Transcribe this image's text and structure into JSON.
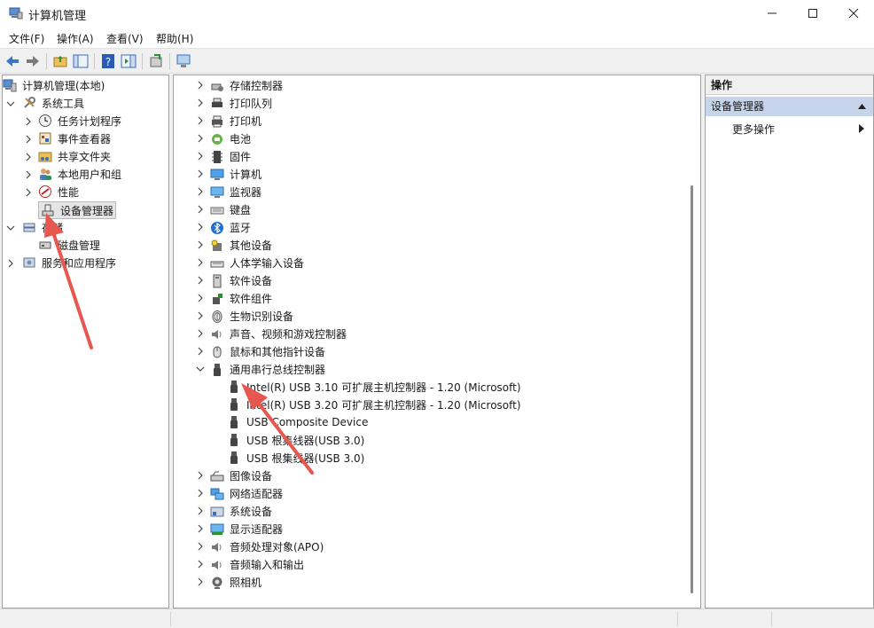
{
  "window": {
    "title": "计算机管理"
  },
  "menu": [
    "文件(F)",
    "操作(A)",
    "查看(V)",
    "帮助(H)"
  ],
  "left_tree": [
    {
      "label": "计算机管理(本地)",
      "icon": "computer-management-icon",
      "indent": 0,
      "chevron": "none"
    },
    {
      "label": "系统工具",
      "icon": "tools-icon",
      "indent": 1,
      "chevron": "down"
    },
    {
      "label": "任务计划程序",
      "icon": "clock-icon",
      "indent": 2,
      "chevron": "right"
    },
    {
      "label": "事件查看器",
      "icon": "event-viewer-icon",
      "indent": 2,
      "chevron": "right"
    },
    {
      "label": "共享文件夹",
      "icon": "shared-folder-icon",
      "indent": 2,
      "chevron": "right"
    },
    {
      "label": "本地用户和组",
      "icon": "users-icon",
      "indent": 2,
      "chevron": "right"
    },
    {
      "label": "性能",
      "icon": "performance-icon",
      "indent": 2,
      "chevron": "right"
    },
    {
      "label": "设备管理器",
      "icon": "device-manager-icon",
      "indent": 2,
      "chevron": "none",
      "selected": true
    },
    {
      "label": "存储",
      "icon": "storage-icon",
      "indent": 1,
      "chevron": "down"
    },
    {
      "label": "磁盘管理",
      "icon": "disk-management-icon",
      "indent": 2,
      "chevron": "none"
    },
    {
      "label": "服务和应用程序",
      "icon": "services-icon",
      "indent": 1,
      "chevron": "right"
    }
  ],
  "device_tree": [
    {
      "label": "存储控制器",
      "icon": "storage-controller-icon",
      "expanded": false
    },
    {
      "label": "打印队列",
      "icon": "print-queue-icon",
      "expanded": false
    },
    {
      "label": "打印机",
      "icon": "printer-icon",
      "expanded": false
    },
    {
      "label": "电池",
      "icon": "battery-icon",
      "expanded": false
    },
    {
      "label": "固件",
      "icon": "firmware-icon",
      "expanded": false
    },
    {
      "label": "计算机",
      "icon": "computer-icon",
      "expanded": false
    },
    {
      "label": "监视器",
      "icon": "monitor-icon",
      "expanded": false
    },
    {
      "label": "键盘",
      "icon": "keyboard-icon",
      "expanded": false
    },
    {
      "label": "蓝牙",
      "icon": "bluetooth-icon",
      "expanded": false
    },
    {
      "label": "其他设备",
      "icon": "other-devices-icon",
      "expanded": false
    },
    {
      "label": "人体学输入设备",
      "icon": "hid-icon",
      "expanded": false
    },
    {
      "label": "软件设备",
      "icon": "software-device-icon",
      "expanded": false
    },
    {
      "label": "软件组件",
      "icon": "software-component-icon",
      "expanded": false
    },
    {
      "label": "生物识别设备",
      "icon": "biometric-icon",
      "expanded": false
    },
    {
      "label": "声音、视频和游戏控制器",
      "icon": "sound-icon",
      "expanded": false
    },
    {
      "label": "鼠标和其他指针设备",
      "icon": "mouse-icon",
      "expanded": false
    },
    {
      "label": "通用串行总线控制器",
      "icon": "usb-icon",
      "expanded": true,
      "children": [
        "Intel(R) USB 3.10 可扩展主机控制器 - 1.20 (Microsoft)",
        "Intel(R) USB 3.20 可扩展主机控制器 - 1.20 (Microsoft)",
        "USB Composite Device",
        "USB 根集线器(USB 3.0)",
        "USB 根集线器(USB 3.0)"
      ]
    },
    {
      "label": "图像设备",
      "icon": "imaging-icon",
      "expanded": false
    },
    {
      "label": "网络适配器",
      "icon": "network-adapter-icon",
      "expanded": false
    },
    {
      "label": "系统设备",
      "icon": "system-device-icon",
      "expanded": false
    },
    {
      "label": "显示适配器",
      "icon": "display-adapter-icon",
      "expanded": false
    },
    {
      "label": "音频处理对象(APO)",
      "icon": "audio-apo-icon",
      "expanded": false
    },
    {
      "label": "音频输入和输出",
      "icon": "audio-io-icon",
      "expanded": false
    },
    {
      "label": "照相机",
      "icon": "camera-icon",
      "expanded": false
    }
  ],
  "actions": {
    "header": "操作",
    "group": "设备管理器",
    "more": "更多操作"
  },
  "colors": {
    "annotation_arrow": "#e8574f",
    "action_group_bg": "#c6d5ea",
    "selection_bg": "#e5e5e5"
  }
}
